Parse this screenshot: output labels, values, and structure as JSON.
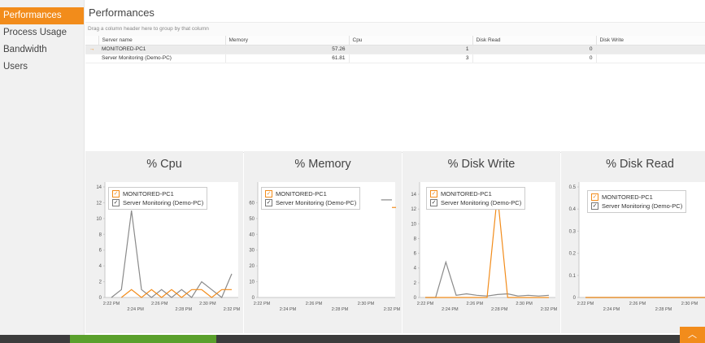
{
  "sidebar": {
    "items": [
      {
        "label": "Performances",
        "active": true
      },
      {
        "label": "Process Usage"
      },
      {
        "label": "Bandwidth"
      },
      {
        "label": "Users"
      }
    ]
  },
  "page": {
    "title": "Performances",
    "group_hint": "Drag a column header here to group by that column"
  },
  "grid": {
    "columns": [
      "Server name",
      "Memory",
      "Cpu",
      "Disk Read",
      "Disk Write"
    ],
    "rows": [
      {
        "server": "MONITORED-PC1",
        "memory": "57.26",
        "cpu": "1",
        "disk_read": "0",
        "disk_write": "",
        "selected": true
      },
      {
        "server": "Server Monitoring (Demo-PC)",
        "memory": "61.81",
        "cpu": "3",
        "disk_read": "0",
        "disk_write": "",
        "selected": false
      }
    ],
    "row_indicator": "→"
  },
  "legend": {
    "series1": "MONITORED-PC1",
    "series2": "Server Monitoring (Demo-PC)"
  },
  "colors": {
    "series1": "#f28c1b",
    "series2": "#8a8a8a",
    "accent": "#f28c1b"
  },
  "chart_data": [
    {
      "type": "line",
      "title": "% Cpu",
      "ylim": [
        0,
        14
      ],
      "yticks": [
        "0",
        "2",
        "4",
        "6",
        "8",
        "10",
        "12",
        "14"
      ],
      "x_top": [
        "2:22 PM",
        "2:26 PM",
        "2:30 PM"
      ],
      "x_bottom": [
        "2:24 PM",
        "2:28 PM",
        "2:32 PM"
      ],
      "series": [
        {
          "name": "MONITORED-PC1",
          "values": [
            null,
            0,
            1,
            0,
            1,
            0,
            1,
            0,
            1,
            1,
            0,
            1,
            1
          ]
        },
        {
          "name": "Server Monitoring (Demo-PC)",
          "values": [
            0,
            1,
            11,
            1,
            0,
            1,
            0,
            1,
            0,
            2,
            1,
            0,
            3
          ]
        }
      ]
    },
    {
      "type": "line",
      "title": "% Memory",
      "ylim": [
        0,
        70
      ],
      "yticks": [
        "0",
        "10",
        "20",
        "30",
        "40",
        "50",
        "60"
      ],
      "x_top": [
        "2:22 PM",
        "2:26 PM",
        "2:30 PM"
      ],
      "x_bottom": [
        "2:24 PM",
        "2:28 PM",
        "2:32 PM"
      ],
      "series": [
        {
          "name": "MONITORED-PC1",
          "values": [
            null,
            null,
            null,
            null,
            null,
            null,
            null,
            null,
            null,
            null,
            null,
            null,
            57
          ]
        },
        {
          "name": "Server Monitoring (Demo-PC)",
          "values": [
            null,
            null,
            null,
            null,
            null,
            null,
            null,
            null,
            null,
            null,
            null,
            61.8,
            61.8
          ]
        }
      ]
    },
    {
      "type": "line",
      "title": "% Disk Write",
      "ylim": [
        0,
        15
      ],
      "yticks": [
        "0",
        "2",
        "4",
        "6",
        "8",
        "10",
        "12",
        "14"
      ],
      "x_top": [
        "2:22 PM",
        "2:26 PM",
        "2:30 PM"
      ],
      "x_bottom": [
        "2:24 PM",
        "2:28 PM",
        "2:32 PM"
      ],
      "series": [
        {
          "name": "MONITORED-PC1",
          "values": [
            0,
            0,
            0,
            0,
            0,
            0,
            0,
            14,
            0,
            0,
            0,
            0,
            0
          ]
        },
        {
          "name": "Server Monitoring (Demo-PC)",
          "values": [
            0,
            0,
            4.8,
            0.3,
            0.5,
            0.3,
            0.2,
            0.4,
            0.5,
            0.2,
            0.3,
            0.2,
            0.3
          ]
        }
      ]
    },
    {
      "type": "line",
      "title": "% Disk Read",
      "ylim": [
        0,
        0.5
      ],
      "yticks": [
        "0",
        "0.1",
        "0.2",
        "0.3",
        "0.4",
        "0.5"
      ],
      "x_top": [
        "2:22 PM",
        "2:26 PM",
        "2:30 PM"
      ],
      "x_bottom": [
        "2:24 PM",
        "2:28 PM",
        "2:32"
      ],
      "series": [
        {
          "name": "MONITORED-PC1",
          "values": [
            0,
            0,
            0,
            0,
            0,
            0,
            0,
            0,
            0,
            0,
            0,
            0,
            0
          ]
        },
        {
          "name": "Server Monitoring (Demo-PC)",
          "values": [
            0,
            0,
            0,
            0,
            0,
            0,
            0,
            0,
            0,
            0,
            0,
            0,
            0
          ]
        }
      ]
    }
  ]
}
